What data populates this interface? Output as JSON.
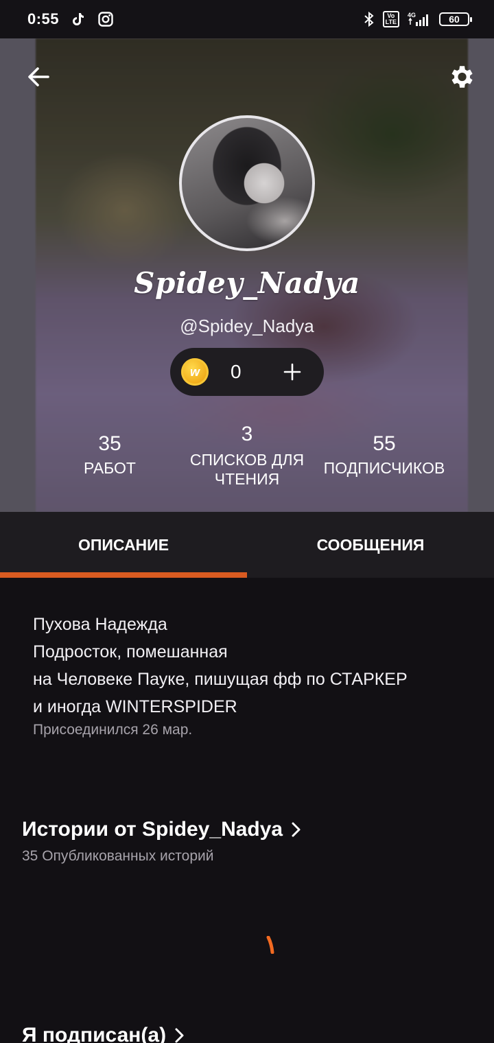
{
  "status_bar": {
    "time": "0:55",
    "icons_left": [
      "tiktok-icon",
      "instagram-icon"
    ],
    "icons_right": [
      "bluetooth-icon",
      "volte-icon",
      "signal-4g-icon",
      "battery-icon"
    ],
    "volte_text": "Vo\nLTE",
    "network": "4G",
    "battery": "60"
  },
  "header": {
    "display_name": "Spidey_Nadya",
    "username": "@Spidey_Nadya",
    "coins": "0",
    "coin_glyph": "w"
  },
  "stats": {
    "works": {
      "value": "35",
      "label": "РАБОТ"
    },
    "reading_lists": {
      "value": "3",
      "label_line1": "СПИСКОВ ДЛЯ",
      "label_line2": "ЧТЕНИЯ"
    },
    "followers": {
      "value": "55",
      "label": "ПОДПИСЧИКОВ"
    }
  },
  "tabs": [
    {
      "label": "ОПИСАНИЕ",
      "active": true
    },
    {
      "label": "СООБЩЕНИЯ",
      "active": false
    }
  ],
  "about": {
    "bio": [
      "Пухова Надежда",
      "Подросток, помешанная",
      "на Человеке Пауке, пишущая фф по СТАРКЕР",
      "и иногда WINTERSPIDER"
    ],
    "joined": "Присоединился 26 мар."
  },
  "stories": {
    "title": "Истории от Spidey_Nadya",
    "subtitle": "35 Опубликованных историй"
  },
  "following": {
    "title": "Я подписан(а)"
  },
  "colors": {
    "accent": "#d95b21",
    "background": "#121014",
    "tab_bar": "#1e1c20",
    "secondary_text": "#a7a3ab"
  }
}
